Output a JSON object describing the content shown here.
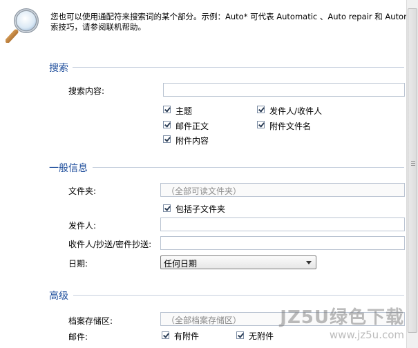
{
  "hint": {
    "line1": "您也可以使用通配符来搜索词的某个部分。示例：Auto* 可代表 Automatic 、Auto repair 和 Automobile",
    "line2": "索技巧，请参阅联机帮助。"
  },
  "search_section": {
    "title": "搜索",
    "content_label": "搜索内容:",
    "content_value": "",
    "checkboxes": [
      {
        "label": "主题",
        "checked": true
      },
      {
        "label": "发件人/收件人",
        "checked": true
      },
      {
        "label": "邮件正文",
        "checked": true
      },
      {
        "label": "附件文件名",
        "checked": true
      },
      {
        "label": "附件内容",
        "checked": true
      }
    ]
  },
  "general_section": {
    "title": "一般信息",
    "folder_label": "文件夹:",
    "folder_placeholder": "（全部可读文件夹）",
    "subfolder_label": "包括子文件夹",
    "subfolder_checked": true,
    "sender_label": "发件人:",
    "sender_value": "",
    "recipients_label": "收件人/抄送/密件抄送:",
    "recipients_value": "",
    "date_label": "日期:",
    "date_value": "任何日期"
  },
  "advanced_section": {
    "title": "高级",
    "archive_label": "档案存储区:",
    "archive_placeholder": "（全部档案存储区）",
    "mail_label": "邮件:",
    "has_attachment_label": "有附件",
    "has_attachment_checked": true,
    "no_attachment_label": "无附件",
    "no_attachment_checked": true
  },
  "watermark": {
    "brand": "JZ5U绿色下载",
    "url": "www.jz5u.com"
  },
  "icons": {
    "hint_icon": "magnifier-icon"
  }
}
